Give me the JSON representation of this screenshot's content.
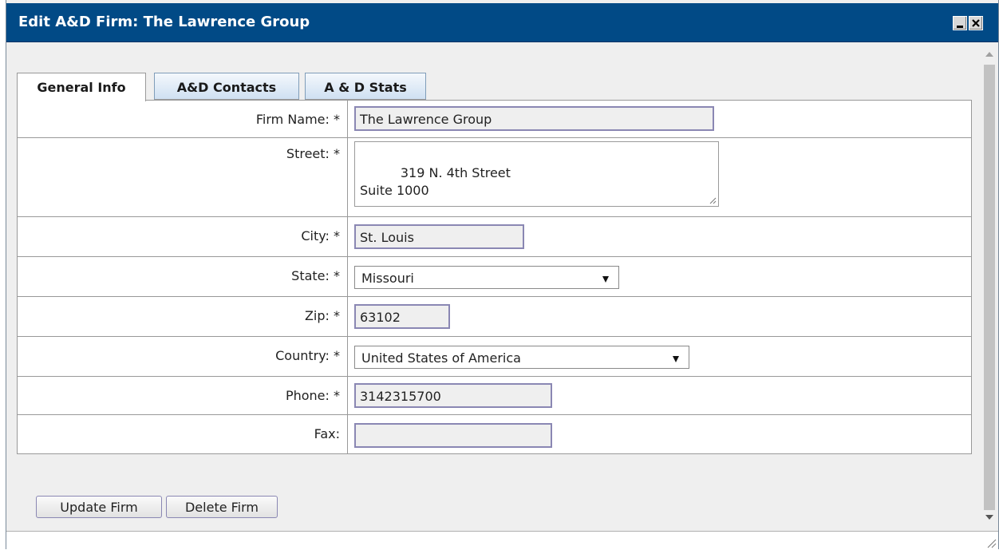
{
  "window": {
    "title": "Edit A&D Firm: The Lawrence Group"
  },
  "tabs": [
    {
      "label": "General Info",
      "active": true
    },
    {
      "label": "A&D Contacts",
      "active": false
    },
    {
      "label": "A & D Stats",
      "active": false
    }
  ],
  "form": {
    "firm_name": {
      "label": "Firm Name: *",
      "value": "The Lawrence Group"
    },
    "street": {
      "label": "Street: *",
      "value": "319 N. 4th Street\nSuite 1000"
    },
    "city": {
      "label": "City: *",
      "value": "St. Louis"
    },
    "state": {
      "label": "State: *",
      "value": "Missouri"
    },
    "zip": {
      "label": "Zip: *",
      "value": "63102"
    },
    "country": {
      "label": "Country: *",
      "value": "United States of America"
    },
    "phone": {
      "label": "Phone: *",
      "value": "3142315700"
    },
    "fax": {
      "label": "Fax:",
      "value": ""
    }
  },
  "buttons": {
    "update_label": "Update Firm",
    "delete_label": "Delete Firm"
  },
  "colors": {
    "titlebar": "#014a86",
    "input_border": "#8a87b3",
    "tab_inactive": "#cfe0f2"
  },
  "icons": [
    "minimize-icon",
    "close-icon",
    "scroll-up-icon",
    "scroll-down-icon",
    "resize-grip-icon",
    "dropdown-arrow-icon"
  ]
}
